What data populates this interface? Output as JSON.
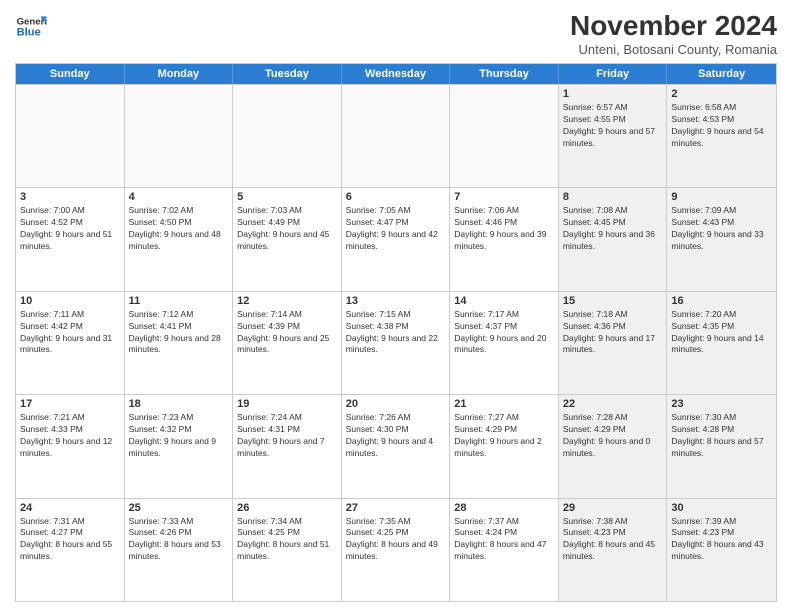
{
  "header": {
    "logo": {
      "general": "General",
      "blue": "Blue"
    },
    "title": "November 2024",
    "subtitle": "Unteni, Botosani County, Romania"
  },
  "days_of_week": [
    "Sunday",
    "Monday",
    "Tuesday",
    "Wednesday",
    "Thursday",
    "Friday",
    "Saturday"
  ],
  "weeks": [
    [
      {
        "day": "",
        "info": "",
        "empty": true
      },
      {
        "day": "",
        "info": "",
        "empty": true
      },
      {
        "day": "",
        "info": "",
        "empty": true
      },
      {
        "day": "",
        "info": "",
        "empty": true
      },
      {
        "day": "",
        "info": "",
        "empty": true
      },
      {
        "day": "1",
        "info": "Sunrise: 6:57 AM\nSunset: 4:55 PM\nDaylight: 9 hours and 57 minutes.",
        "shaded": true
      },
      {
        "day": "2",
        "info": "Sunrise: 6:58 AM\nSunset: 4:53 PM\nDaylight: 9 hours and 54 minutes.",
        "shaded": true
      }
    ],
    [
      {
        "day": "3",
        "info": "Sunrise: 7:00 AM\nSunset: 4:52 PM\nDaylight: 9 hours and 51 minutes."
      },
      {
        "day": "4",
        "info": "Sunrise: 7:02 AM\nSunset: 4:50 PM\nDaylight: 9 hours and 48 minutes."
      },
      {
        "day": "5",
        "info": "Sunrise: 7:03 AM\nSunset: 4:49 PM\nDaylight: 9 hours and 45 minutes."
      },
      {
        "day": "6",
        "info": "Sunrise: 7:05 AM\nSunset: 4:47 PM\nDaylight: 9 hours and 42 minutes."
      },
      {
        "day": "7",
        "info": "Sunrise: 7:06 AM\nSunset: 4:46 PM\nDaylight: 9 hours and 39 minutes."
      },
      {
        "day": "8",
        "info": "Sunrise: 7:08 AM\nSunset: 4:45 PM\nDaylight: 9 hours and 36 minutes.",
        "shaded": true
      },
      {
        "day": "9",
        "info": "Sunrise: 7:09 AM\nSunset: 4:43 PM\nDaylight: 9 hours and 33 minutes.",
        "shaded": true
      }
    ],
    [
      {
        "day": "10",
        "info": "Sunrise: 7:11 AM\nSunset: 4:42 PM\nDaylight: 9 hours and 31 minutes."
      },
      {
        "day": "11",
        "info": "Sunrise: 7:12 AM\nSunset: 4:41 PM\nDaylight: 9 hours and 28 minutes."
      },
      {
        "day": "12",
        "info": "Sunrise: 7:14 AM\nSunset: 4:39 PM\nDaylight: 9 hours and 25 minutes."
      },
      {
        "day": "13",
        "info": "Sunrise: 7:15 AM\nSunset: 4:38 PM\nDaylight: 9 hours and 22 minutes."
      },
      {
        "day": "14",
        "info": "Sunrise: 7:17 AM\nSunset: 4:37 PM\nDaylight: 9 hours and 20 minutes."
      },
      {
        "day": "15",
        "info": "Sunrise: 7:18 AM\nSunset: 4:36 PM\nDaylight: 9 hours and 17 minutes.",
        "shaded": true
      },
      {
        "day": "16",
        "info": "Sunrise: 7:20 AM\nSunset: 4:35 PM\nDaylight: 9 hours and 14 minutes.",
        "shaded": true
      }
    ],
    [
      {
        "day": "17",
        "info": "Sunrise: 7:21 AM\nSunset: 4:33 PM\nDaylight: 9 hours and 12 minutes."
      },
      {
        "day": "18",
        "info": "Sunrise: 7:23 AM\nSunset: 4:32 PM\nDaylight: 9 hours and 9 minutes."
      },
      {
        "day": "19",
        "info": "Sunrise: 7:24 AM\nSunset: 4:31 PM\nDaylight: 9 hours and 7 minutes."
      },
      {
        "day": "20",
        "info": "Sunrise: 7:26 AM\nSunset: 4:30 PM\nDaylight: 9 hours and 4 minutes."
      },
      {
        "day": "21",
        "info": "Sunrise: 7:27 AM\nSunset: 4:29 PM\nDaylight: 9 hours and 2 minutes."
      },
      {
        "day": "22",
        "info": "Sunrise: 7:28 AM\nSunset: 4:29 PM\nDaylight: 9 hours and 0 minutes.",
        "shaded": true
      },
      {
        "day": "23",
        "info": "Sunrise: 7:30 AM\nSunset: 4:28 PM\nDaylight: 8 hours and 57 minutes.",
        "shaded": true
      }
    ],
    [
      {
        "day": "24",
        "info": "Sunrise: 7:31 AM\nSunset: 4:27 PM\nDaylight: 8 hours and 55 minutes."
      },
      {
        "day": "25",
        "info": "Sunrise: 7:33 AM\nSunset: 4:26 PM\nDaylight: 8 hours and 53 minutes."
      },
      {
        "day": "26",
        "info": "Sunrise: 7:34 AM\nSunset: 4:25 PM\nDaylight: 8 hours and 51 minutes."
      },
      {
        "day": "27",
        "info": "Sunrise: 7:35 AM\nSunset: 4:25 PM\nDaylight: 8 hours and 49 minutes."
      },
      {
        "day": "28",
        "info": "Sunrise: 7:37 AM\nSunset: 4:24 PM\nDaylight: 8 hours and 47 minutes."
      },
      {
        "day": "29",
        "info": "Sunrise: 7:38 AM\nSunset: 4:23 PM\nDaylight: 8 hours and 45 minutes.",
        "shaded": true
      },
      {
        "day": "30",
        "info": "Sunrise: 7:39 AM\nSunset: 4:23 PM\nDaylight: 8 hours and 43 minutes.",
        "shaded": true
      }
    ]
  ]
}
